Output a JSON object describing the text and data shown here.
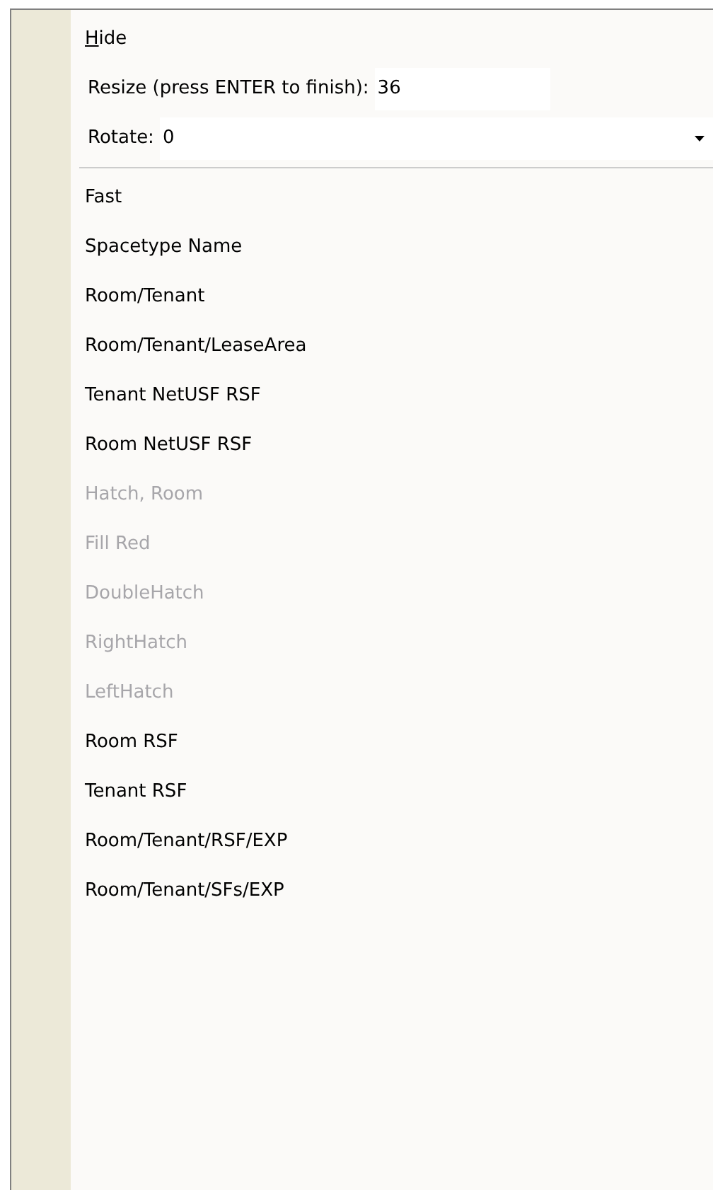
{
  "menu": {
    "hide": {
      "label": "Hide",
      "mnemonic_underlined": true
    },
    "resize": {
      "label": "Resize  (press ENTER to finish):",
      "value": "36"
    },
    "rotate": {
      "label": "Rotate:",
      "value": "0"
    },
    "items": [
      {
        "label": "Fast",
        "disabled": false
      },
      {
        "label": "Spacetype Name",
        "disabled": false
      },
      {
        "label": "Room/Tenant",
        "disabled": false
      },
      {
        "label": "Room/Tenant/LeaseArea",
        "disabled": false
      },
      {
        "label": "Tenant NetUSF RSF",
        "disabled": false
      },
      {
        "label": "Room NetUSF RSF",
        "disabled": false
      },
      {
        "label": "Hatch, Room",
        "disabled": true
      },
      {
        "label": "Fill Red",
        "disabled": true
      },
      {
        "label": "DoubleHatch",
        "disabled": true
      },
      {
        "label": "RightHatch",
        "disabled": true
      },
      {
        "label": "LeftHatch",
        "disabled": true
      },
      {
        "label": "Room RSF",
        "disabled": false
      },
      {
        "label": "Tenant RSF",
        "disabled": false
      },
      {
        "label": "Room/Tenant/RSF/EXP",
        "disabled": false
      },
      {
        "label": "Room/Tenant/SFs/EXP",
        "disabled": false
      }
    ]
  }
}
